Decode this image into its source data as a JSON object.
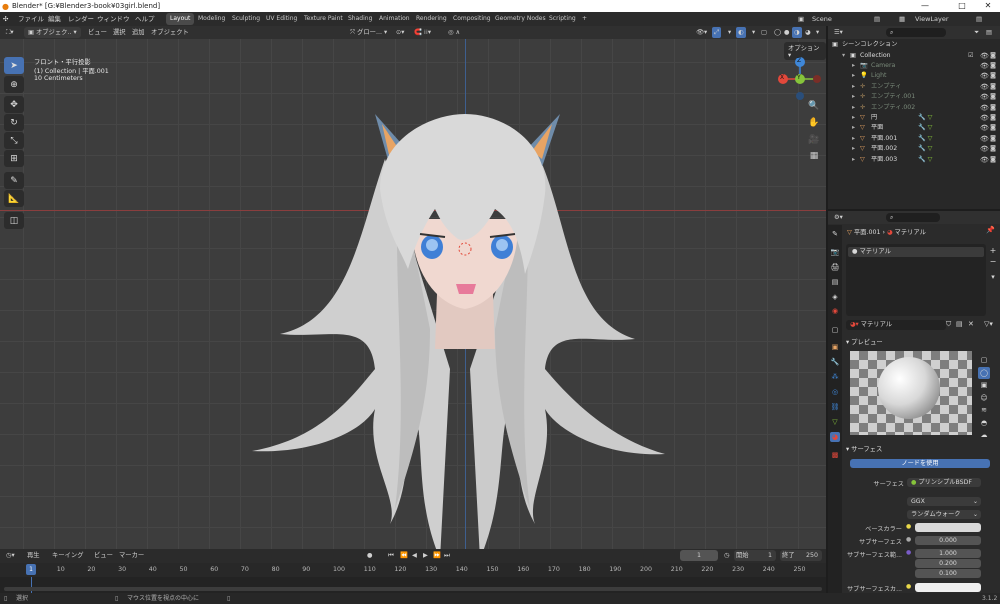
{
  "window": {
    "title": "Blender* [G:¥Blender3-book¥03girl.blend]",
    "min": "—",
    "max": "□",
    "close": "✕"
  },
  "menu": {
    "items": [
      "ファイル",
      "編集",
      "レンダー",
      "ウィンドウ",
      "ヘルプ"
    ]
  },
  "workspaces": {
    "tabs": [
      "Layout",
      "Modeling",
      "Sculpting",
      "UV Editing",
      "Texture Paint",
      "Shading",
      "Animation",
      "Rendering",
      "Compositing",
      "Geometry Nodes",
      "Scripting"
    ],
    "add": "+",
    "active": "Layout"
  },
  "scene": {
    "label": "Scene",
    "viewlayer": "ViewLayer"
  },
  "viewport": {
    "mode": "オブジェク..",
    "menus": [
      "ビュー",
      "選択",
      "追加",
      "オブジェクト"
    ],
    "transform": "グロー...",
    "options": "オプション",
    "info": {
      "view": "フロント・平行投影",
      "collection": "(1) Collection | 平面.001",
      "scale": "10 Centimeters"
    }
  },
  "gizmo": {
    "z": "Z",
    "y": "Y",
    "x": "X"
  },
  "timeline": {
    "menus": [
      "再生",
      "キーイング",
      "ビュー",
      "マーカー"
    ],
    "current": "1",
    "start_label": "開始",
    "start": "1",
    "end_label": "終了",
    "end": "250",
    "ticks": [
      "0",
      "10",
      "20",
      "30",
      "40",
      "50",
      "60",
      "70",
      "80",
      "90",
      "100",
      "110",
      "120",
      "130",
      "140",
      "150",
      "160",
      "170",
      "180",
      "190",
      "200",
      "210",
      "220",
      "230",
      "240",
      "250"
    ],
    "marker": "1"
  },
  "status": {
    "select": "選択",
    "center": "マウス位置を視点の中心に",
    "version": "3.1.2"
  },
  "outliner": {
    "root": "シーンコレクション",
    "rows": [
      {
        "name": "Collection",
        "color": "#ddd"
      },
      {
        "name": "Camera",
        "color": "#7a8a7a"
      },
      {
        "name": "Light",
        "color": "#7a8a7a"
      },
      {
        "name": "エンプティ",
        "color": "#7a8a7a"
      },
      {
        "name": "エンプティ.001",
        "color": "#7a8a7a"
      },
      {
        "name": "エンプティ.002",
        "color": "#7a8a7a"
      },
      {
        "name": "円",
        "color": "#ddd"
      },
      {
        "name": "平面",
        "color": "#ddd"
      },
      {
        "name": "平面.001",
        "color": "#ddd"
      },
      {
        "name": "平面.002",
        "color": "#ddd"
      },
      {
        "name": "平面.003",
        "color": "#ddd"
      }
    ]
  },
  "properties": {
    "breadcrumb_obj": "平面.001",
    "breadcrumb_mat": "マテリアル",
    "slot": "マテリアル",
    "material_name": "マテリアル",
    "preview_label": "プレビュー",
    "surface_label": "サーフェス",
    "use_nodes": "ノードを使用",
    "surface_field_label": "サーフェス",
    "surface_value": "プリンシプルBSDF",
    "distribution": "GGX",
    "subsurface_method": "ランダムウォーク",
    "base_color_label": "ベースカラー",
    "subsurface_label": "サブサーフェス",
    "subsurface_value": "0.000",
    "subsurface_radius_label": "サブサーフェス範...",
    "radius": [
      "1.000",
      "0.200",
      "0.100"
    ],
    "subsurface_color_label": "サブサーフェスカ..."
  },
  "colors": {
    "accent": "#4772b3",
    "x_axis": "#e2483b",
    "y_axis": "#86c43b",
    "z_axis": "#3f87d8"
  }
}
